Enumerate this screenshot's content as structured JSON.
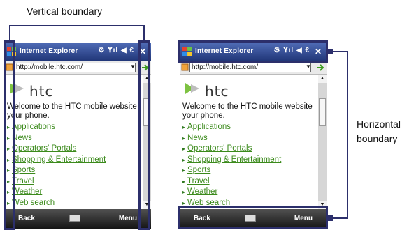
{
  "captions": {
    "vertical": "Vertical boundary",
    "horizontal_line1": "Horizontal",
    "horizontal_line2": "boundary"
  },
  "phone": {
    "title": "Internet Explorer",
    "status_icons": "⚙ 𝐘ıl ◀ €",
    "close_label": "✕",
    "address": "http://mobile.htc.com/",
    "logo_text": "htc",
    "welcome_line1": "Welcome to the HTC mobile website",
    "welcome_line2": "your phone.",
    "links": [
      "Applications",
      "News",
      "Operators' Portals",
      "Shopping & Entertainment",
      "Sports",
      "Travel",
      "Weather",
      "Web search"
    ],
    "softkey_left": "Back",
    "softkey_right": "Menu"
  },
  "colors": {
    "annotation": "#2c2f6b",
    "title_bar": "#1f3576",
    "link": "#3b8a1b",
    "softbar": "#151515"
  }
}
